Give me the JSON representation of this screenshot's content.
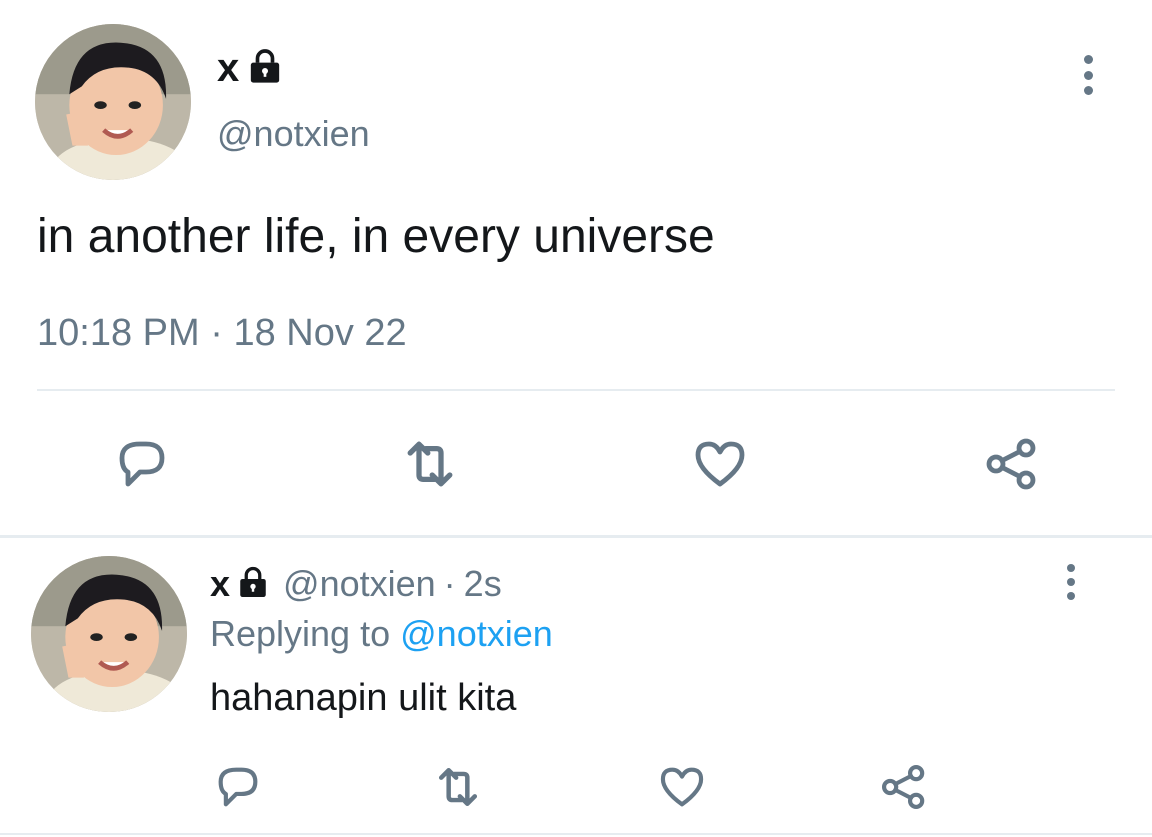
{
  "main_tweet": {
    "display_name": "x",
    "handle": "@notxien",
    "text": "in another life, in every universe",
    "time": "10:18 PM",
    "separator": "·",
    "date": "18 Nov 22",
    "icons": [
      "lock-icon",
      "more-icon",
      "reply-icon",
      "retweet-icon",
      "like-icon",
      "share-icon"
    ]
  },
  "reply_tweet": {
    "display_name": "x",
    "handle": "@notxien",
    "separator": "·",
    "age": "2s",
    "replying_prefix": "Replying to",
    "replying_handle": "@notxien",
    "text": "hahanapin ulit kita"
  },
  "colors": {
    "text": "#14171a",
    "secondary": "#657786",
    "link": "#1da1f2",
    "divider": "#e6ecf0"
  }
}
